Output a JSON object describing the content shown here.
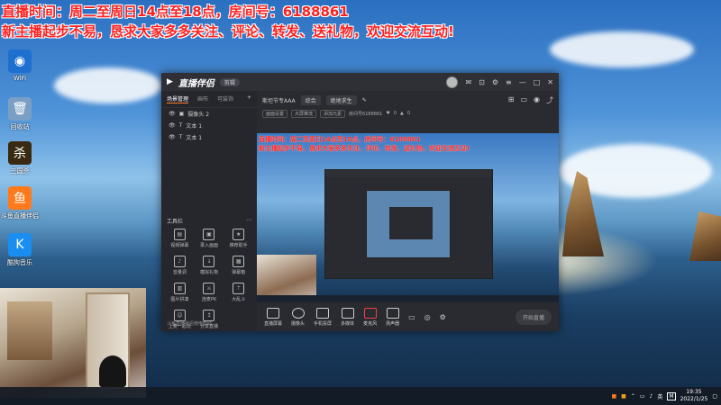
{
  "overlay": {
    "line1": "直播时间：周二至周日14点至18点，房间号：6188861",
    "line2": "新主播起步不易，恳求大家多多关注、评论、转发、送礼物，欢迎交流互动!"
  },
  "desktop_icons": [
    {
      "label": "WiFi"
    },
    {
      "label": "回收站"
    },
    {
      "label": "三国杀"
    },
    {
      "label": "斗鱼直播伴侣"
    },
    {
      "label": "酷狗音乐"
    }
  ],
  "app": {
    "name": "直播伴侣",
    "badge": "剪辑",
    "tabs": [
      "场景管理",
      "画布",
      "可装饰"
    ],
    "scenes": [
      "摄像头 2",
      "文本 1",
      "文本 1"
    ],
    "tools_title": "工具栏",
    "tools": [
      {
        "label": "视频弹幕"
      },
      {
        "label": "录入画面"
      },
      {
        "label": "推荐助手"
      },
      {
        "label": "音量调"
      },
      {
        "label": "模拟礼物"
      },
      {
        "label": "弹幕箱"
      },
      {
        "label": "图片拼凑"
      },
      {
        "label": "连麦PK"
      },
      {
        "label": "大乱斗"
      },
      {
        "label": "上麦一起玩"
      },
      {
        "label": "分享直播"
      }
    ],
    "bottom_hint": "斗鱼直播伴侣使用帮助",
    "room_name": "斯坦节专AAA",
    "room_tag": "综合",
    "room_category": "绝地求生",
    "toolbar2": [
      "画面设置",
      "大屏推流",
      "添加元素",
      "房间号6188861",
      "0",
      "0"
    ],
    "controls": [
      {
        "label": "直播屏幕"
      },
      {
        "label": "摄像头"
      },
      {
        "label": "手机投屏"
      },
      {
        "label": "多媒体"
      },
      {
        "label": "麦克风"
      },
      {
        "label": "扬声器"
      }
    ],
    "start_button": "开始直播"
  },
  "taskbar": {
    "time": "19:35",
    "date": "2022/1/25",
    "ime": "英",
    "ime2": "M"
  }
}
